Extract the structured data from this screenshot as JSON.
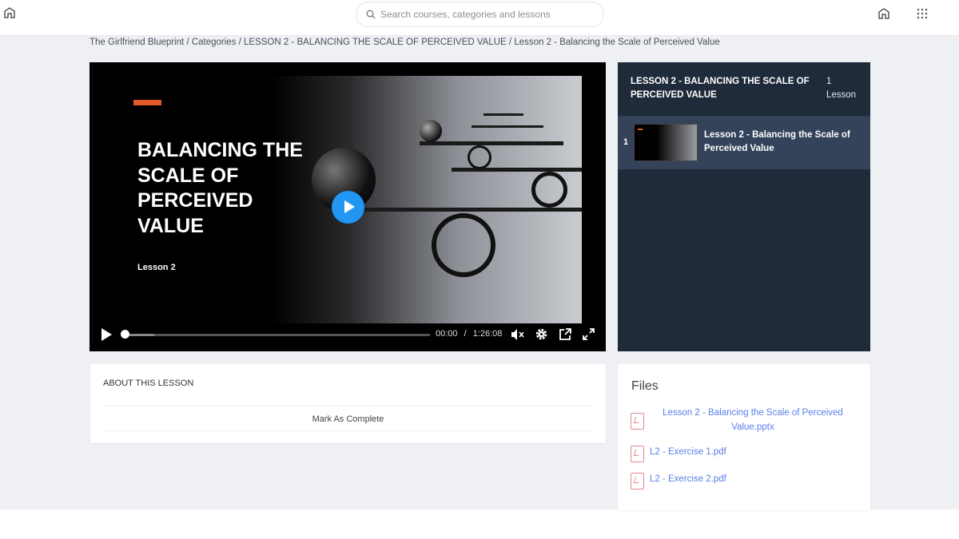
{
  "search": {
    "placeholder": "Search courses, categories and lessons"
  },
  "breadcrumb": "The Girlfriend Blueprint / Categories / LESSON 2 - BALANCING THE SCALE OF PERCEIVED VALUE / Lesson 2 - Balancing the Scale of Perceived Value",
  "video": {
    "title": "BALANCING THE SCALE OF PERCEIVED VALUE",
    "subtitle": "Lesson 2",
    "current_time": "00:00",
    "separator": "/",
    "duration": "1:26:08",
    "progress": 0
  },
  "sidebar": {
    "section_title": "LESSON 2 - BALANCING THE SCALE OF PERCEIVED VALUE",
    "count": "1 Lesson",
    "lessons": [
      {
        "number": "1",
        "title": "Lesson 2 - Balancing the Scale of Perceived Value"
      }
    ]
  },
  "about": {
    "heading": "ABOUT THIS LESSON",
    "mark_complete": "Mark As Complete"
  },
  "files": {
    "heading": "Files",
    "items": [
      "Lesson 2 - Balancing the Scale of Perceived Value.pptx",
      "L2 - Exercise 1.pdf",
      "L2 - Exercise 2.pdf"
    ]
  },
  "colors": {
    "accent": "#2196f3",
    "sidebar": "#1f2a3a",
    "link": "#5a7ee8",
    "orange": "#e4592a"
  }
}
